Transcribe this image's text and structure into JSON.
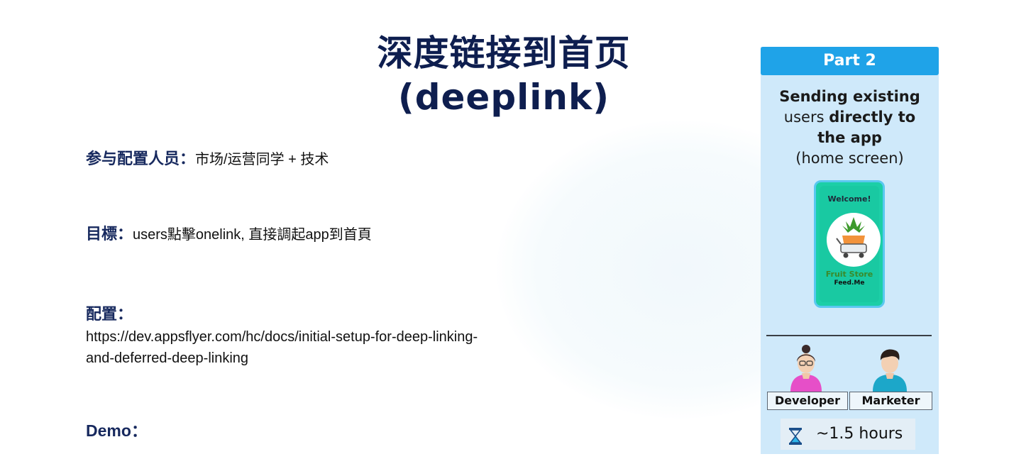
{
  "title": {
    "line1": "深度链接到首页",
    "line2": "(deeplink)"
  },
  "rows": {
    "participants_label": "参与配置人员：",
    "participants_value": "市场/运营同学 + 技术",
    "goal_label": "目標：",
    "goal_value": "users點擊onelink, 直接調起app到首頁",
    "config_label": "配置：",
    "config_url": "https://dev.appsflyer.com/hc/docs/initial-setup-for-deep-linking-and-deferred-deep-linking",
    "demo_label": "Demo："
  },
  "card": {
    "header": "Part 2",
    "desc_bold1": "Sending existing",
    "desc_normal1": "users",
    "desc_bold2": "directly to",
    "desc_bold3": "the app",
    "desc_normal2": "(home screen)",
    "phone_welcome": "Welcome!",
    "phone_store": "Fruit Store",
    "phone_brand": "Feed.Me",
    "developer_label": "Developer",
    "marketer_label": "Marketer",
    "time_label": "~1.5 hours"
  },
  "colors": {
    "title": "#0e1e4f",
    "label": "#17295e",
    "card_bg": "#cfe9fa",
    "card_header": "#1fa3e8"
  },
  "icons": [
    "pineapple-cart-logo-icon",
    "developer-avatar-icon",
    "marketer-avatar-icon",
    "hourglass-icon"
  ]
}
